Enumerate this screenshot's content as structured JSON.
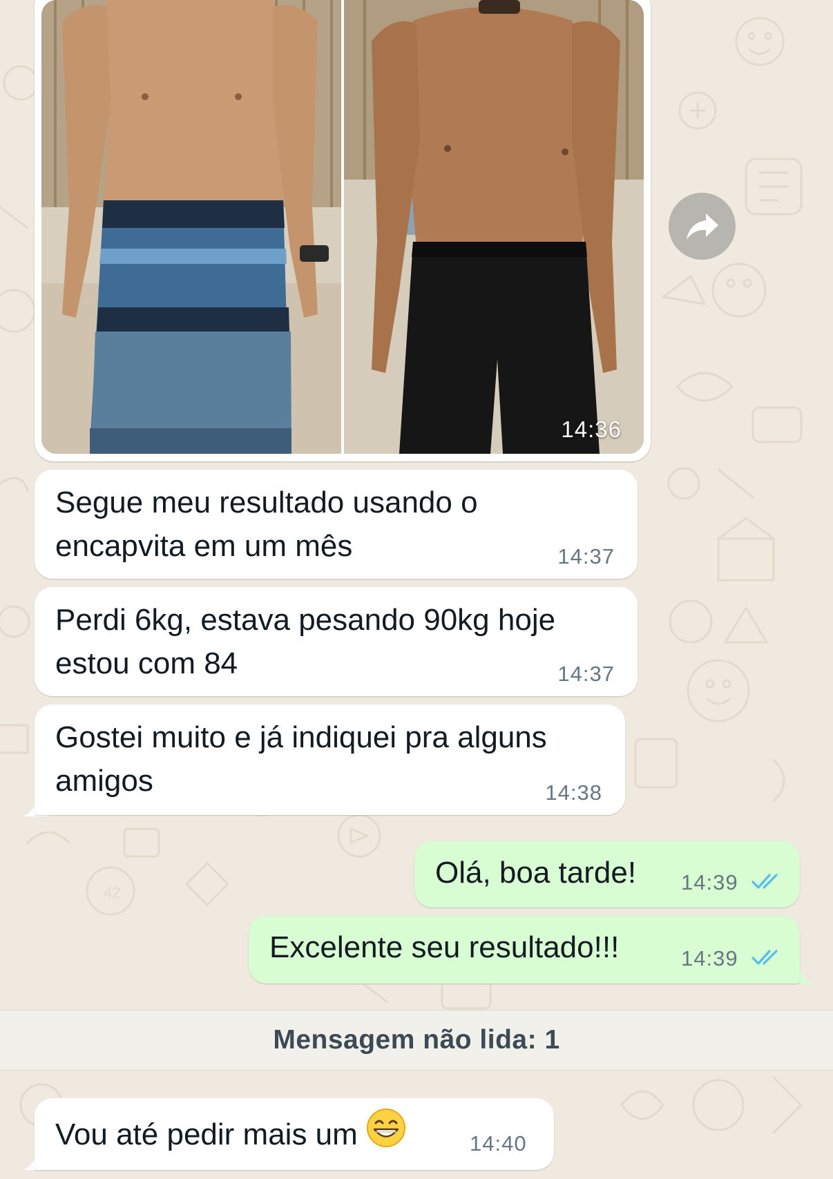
{
  "chat": {
    "photo_message": {
      "time": "14:36"
    },
    "messages": [
      {
        "text_line1": "Segue meu resultado usando o",
        "text_line2": "encapvita em um mês",
        "time": "14:37"
      },
      {
        "text_line1": "Perdi 6kg, estava pesando 90kg hoje",
        "text_line2": "estou com 84",
        "time": "14:37"
      },
      {
        "text_line1": "Gostei muito e já indiquei pra alguns",
        "text_line2": "amigos",
        "time": "14:38"
      },
      {
        "text": "Olá, boa tarde!",
        "time": "14:39",
        "status": "read"
      },
      {
        "text": "Excelente seu resultado!!!",
        "time": "14:39",
        "status": "read"
      },
      {
        "text": "Vou até pedir mais um",
        "emoji": "grinning-face-with-smiling-eyes",
        "time": "14:40"
      }
    ],
    "unread_banner": "Mensagem não lida: 1"
  },
  "colors": {
    "wallpaper": "#efe9df",
    "incoming_bubble": "#ffffff",
    "outgoing_bubble": "#d9fdd3",
    "read_ticks": "#53bdeb",
    "timestamp": "#667781"
  },
  "icons": {
    "forward": "forward-arrow-icon",
    "read_receipt": "double-check-icon"
  }
}
